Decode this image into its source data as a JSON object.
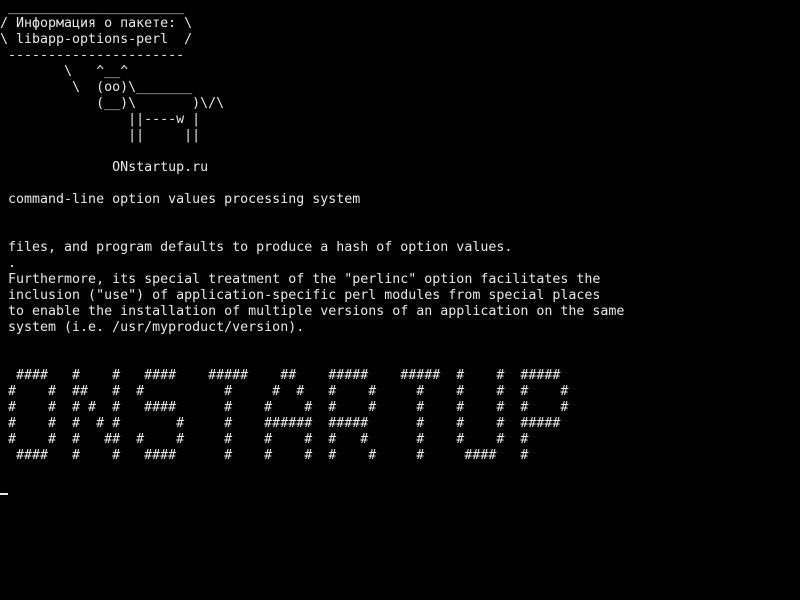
{
  "terminal": {
    "colors": {
      "background": "#000000",
      "foreground": "#e8e8e8"
    },
    "cowsay": [
      " ______________________",
      "/ Информация о пакете: \\",
      "\\ libapp-options-perl  /",
      " ----------------------",
      "        \\   ^__^",
      "         \\  (oo)\\_______",
      "            (__)\\       )\\/\\",
      "                ||----w |",
      "                ||     ||"
    ],
    "site": "              ONstartup.ru",
    "summary": " command-line option values processing system",
    "description": [
      " files, and program defaults to produce a hash of option values.",
      " .",
      " Furthermore, its special treatment of the \"perlinc\" option facilitates the",
      " inclusion (\"use\") of application-specific perl modules from special places",
      " to enable the installation of multiple versions of an application on the same",
      " system (i.e. /usr/myproduct/version)."
    ],
    "banner": [
      "  ####   #    #   ####    #####    ##    #####    #####  #    #  #####",
      " #    #  ##   #  #          #     #  #   #    #     #    #    #  #    #",
      " #    #  # #  #   ####      #    #    #  #    #     #    #    #  #    #",
      " #    #  #  # #       #     #    ######  #####      #    #    #  #####",
      " #    #  #   ##  #    #     #    #    #  #   #      #    #    #  #",
      "  ####   #    #   ####      #    #    #  #    #     #     ####   #"
    ],
    "cursor": "_"
  }
}
